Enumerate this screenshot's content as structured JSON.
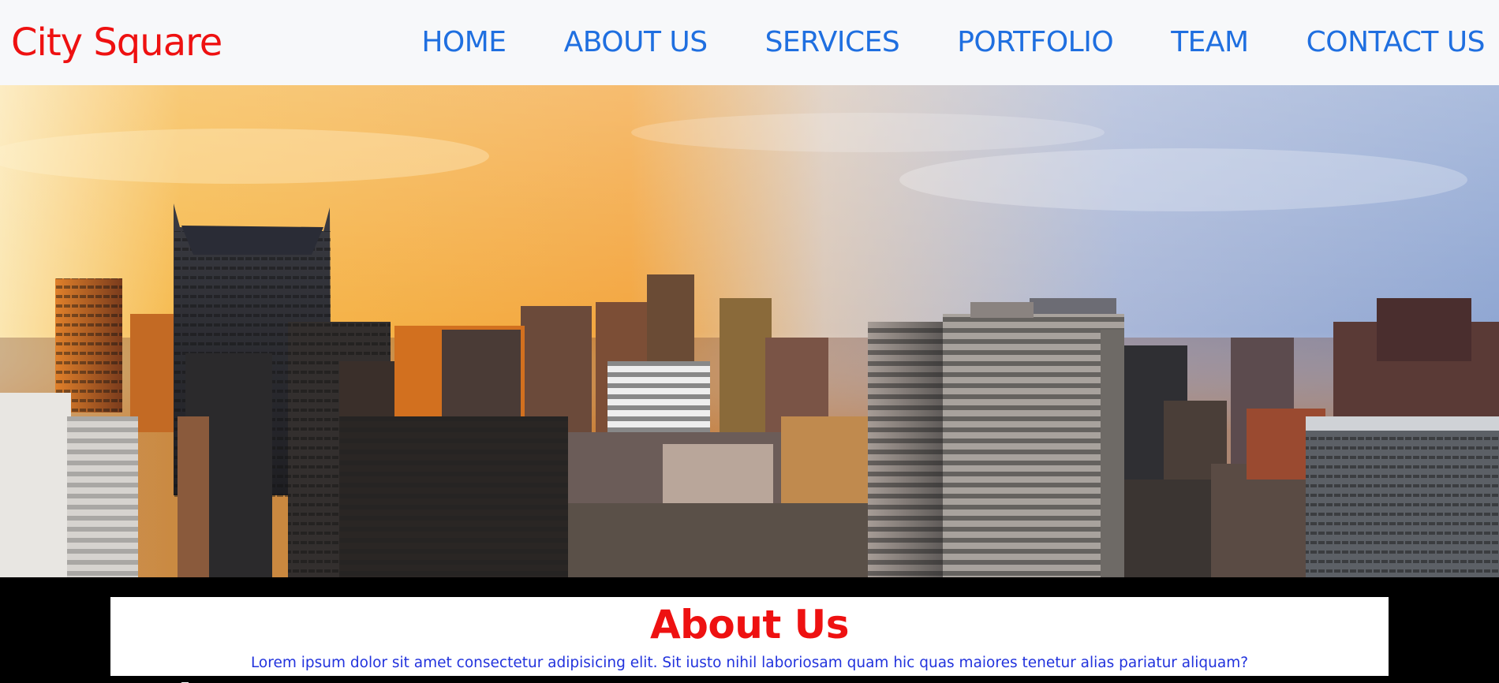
{
  "navbar": {
    "brand": "City Square",
    "links": [
      "HOME",
      "ABOUT US",
      "SERVICES",
      "PORTFOLIO",
      "TEAM",
      "CONTACT US"
    ]
  },
  "hero": {
    "alt": "City skyline at sunset"
  },
  "about": {
    "title": "About Us",
    "text": "Lorem ipsum dolor sit amet consectetur adipisicing elit. Sit iusto nihil laboriosam quam hic quas maiores tenetur alias pariatur aliquam?"
  },
  "colors": {
    "brand": "#ee1111",
    "nav_link": "#1f6fe0",
    "navbar_bg": "#f7f8fa",
    "about_text": "#2233dd",
    "page_bg": "#000000"
  }
}
